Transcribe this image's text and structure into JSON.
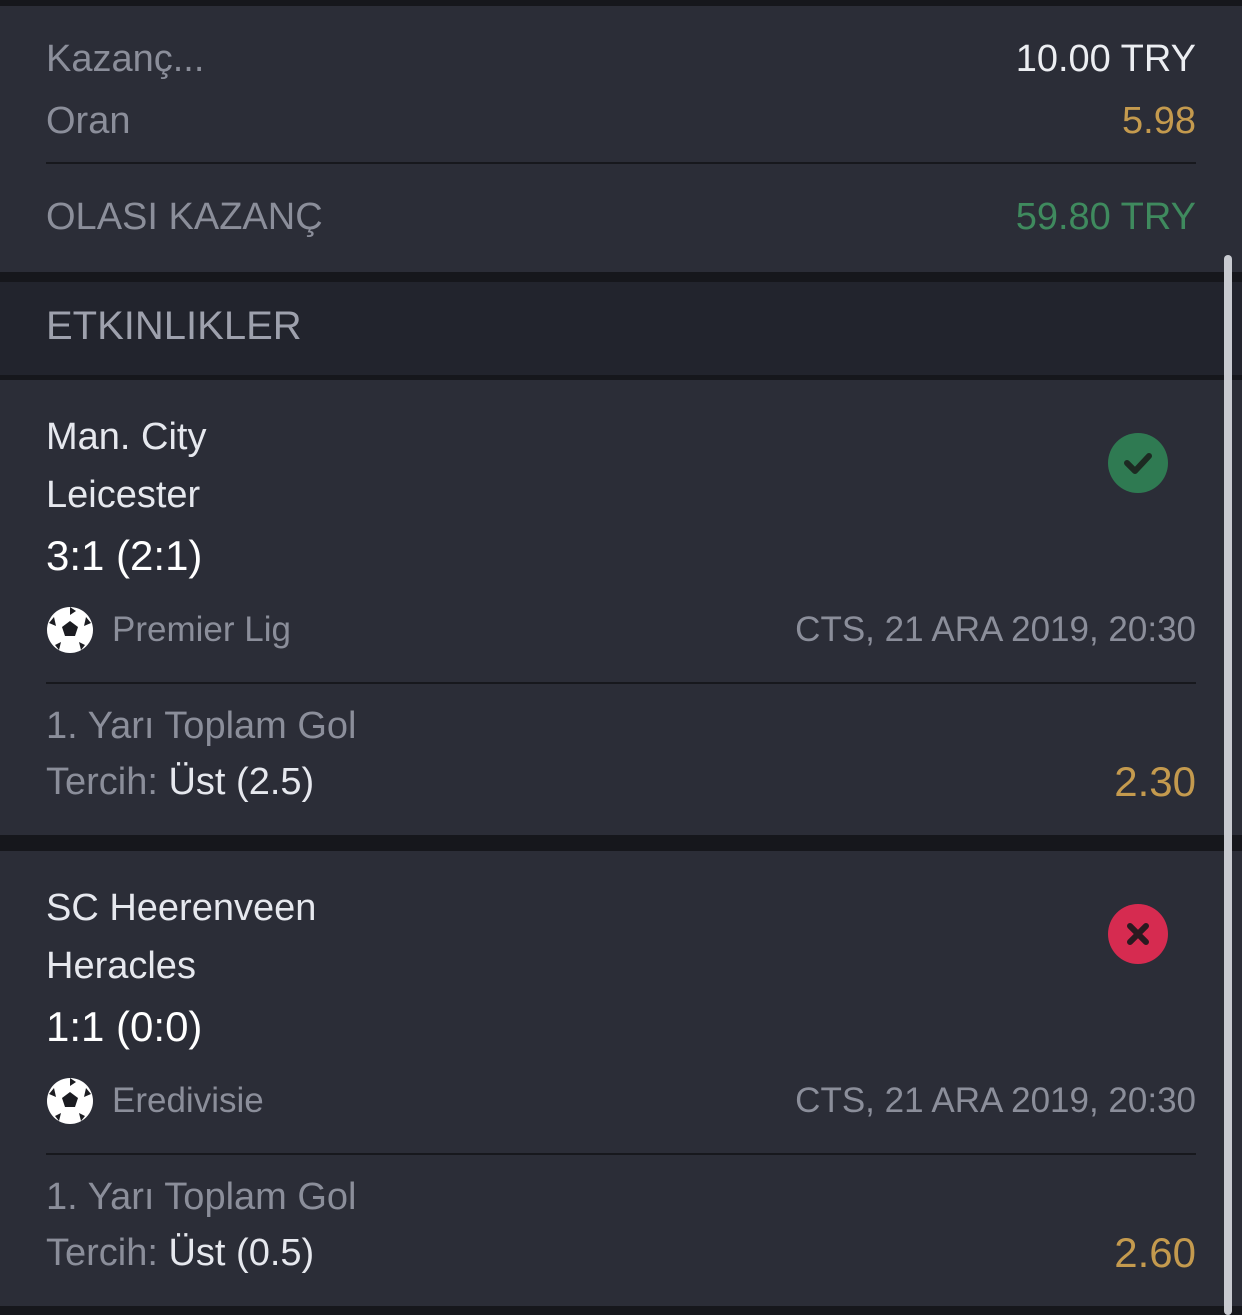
{
  "summary": {
    "stake_label": "Kazanç...",
    "stake_value": "10.00 TRY",
    "odds_label": "Oran",
    "odds_value": "5.98",
    "potential_label": "OLASI KAZANÇ",
    "potential_value": "59.80 TRY"
  },
  "events_header": "ETKINLIKLER",
  "events": [
    {
      "home": "Man. City",
      "away": "Leicester",
      "score": "3:1 (2:1)",
      "league": "Premier Lig",
      "datetime": "CTS, 21 ARA 2019, 20:30",
      "market": "1. Yarı Toplam Gol",
      "pick_label": "Tercih:",
      "pick_value": "Üst (2.5)",
      "odds": "2.30",
      "status": "won",
      "status_icon": "check-circle-icon"
    },
    {
      "home": "SC Heerenveen",
      "away": "Heracles",
      "score": "1:1 (0:0)",
      "league": "Eredivisie",
      "datetime": "CTS, 21 ARA 2019, 20:30",
      "market": "1. Yarı Toplam Gol",
      "pick_label": "Tercih:",
      "pick_value": "Üst (0.5)",
      "odds": "2.60",
      "status": "lost",
      "status_icon": "x-circle-icon"
    }
  ],
  "colors": {
    "odds": "#c49a4e",
    "potential_win": "#3f8a5e",
    "won": "#2f7a52",
    "lost": "#d62b50"
  }
}
